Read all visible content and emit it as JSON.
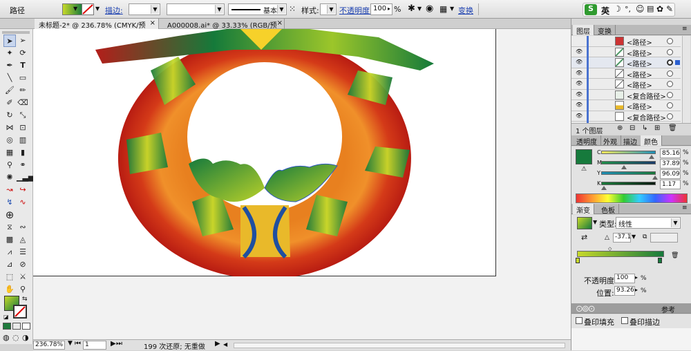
{
  "control_bar": {
    "object_type": "路径",
    "stroke_label": "描边:",
    "stroke_profile": "基本",
    "style_label": "样式:",
    "opacity_label": "不透明度:",
    "opacity_value": "100",
    "opacity_unit": "%",
    "transform_label": "变换"
  },
  "ime": {
    "label": "英"
  },
  "tabs": [
    {
      "label": "未标题-2* @ 236.78% (CMYK/预览)"
    },
    {
      "label": "A000008.ai* @ 33.33% (RGB/预览)"
    }
  ],
  "status": {
    "zoom": "236.78%",
    "page": "1",
    "undo": "199 次还原; 无重做"
  },
  "layers_panel": {
    "tabs": [
      "图层",
      "变换"
    ],
    "items": [
      {
        "name": "<路径>",
        "thumb": "red-dot"
      },
      {
        "name": "<路径>",
        "thumb": "green-stroke"
      },
      {
        "name": "<路径>",
        "thumb": "green-stroke"
      },
      {
        "name": "<路径>",
        "thumb": "line"
      },
      {
        "name": "<路径>",
        "thumb": "line"
      },
      {
        "name": "<复合路径>",
        "thumb": "shape"
      },
      {
        "name": "<路径>",
        "thumb": "yellow"
      },
      {
        "name": "<复合路径>",
        "thumb": "shape"
      }
    ],
    "footer": "1 个图层"
  },
  "color_panel": {
    "tabs": [
      "透明度",
      "外观",
      "描边",
      "颜色"
    ],
    "swatch_color": "#167a3c",
    "c": {
      "label": "C",
      "value": "85.16"
    },
    "m": {
      "label": "M",
      "value": "37.89"
    },
    "y": {
      "label": "Y",
      "value": "96.09"
    },
    "k": {
      "label": "K",
      "value": "1.17"
    },
    "unit": "%"
  },
  "gradient_panel": {
    "tabs": [
      "渐变",
      "色板"
    ],
    "type_label": "类型:",
    "type_value": "线性",
    "angle_value": "-37.1",
    "opacity_label": "不透明度:",
    "opacity_value": "100",
    "location_label": "位置:",
    "location_value": "93.26",
    "unit": "%"
  },
  "attributes_panel": {
    "overprint_fill": "叠印填充",
    "overprint_stroke": "叠印描边",
    "extra_tab": "参考"
  },
  "colors": {
    "accent_green": "#167a3c",
    "gradient_start": "#c7d92a",
    "gradient_end": "#167a3c"
  }
}
